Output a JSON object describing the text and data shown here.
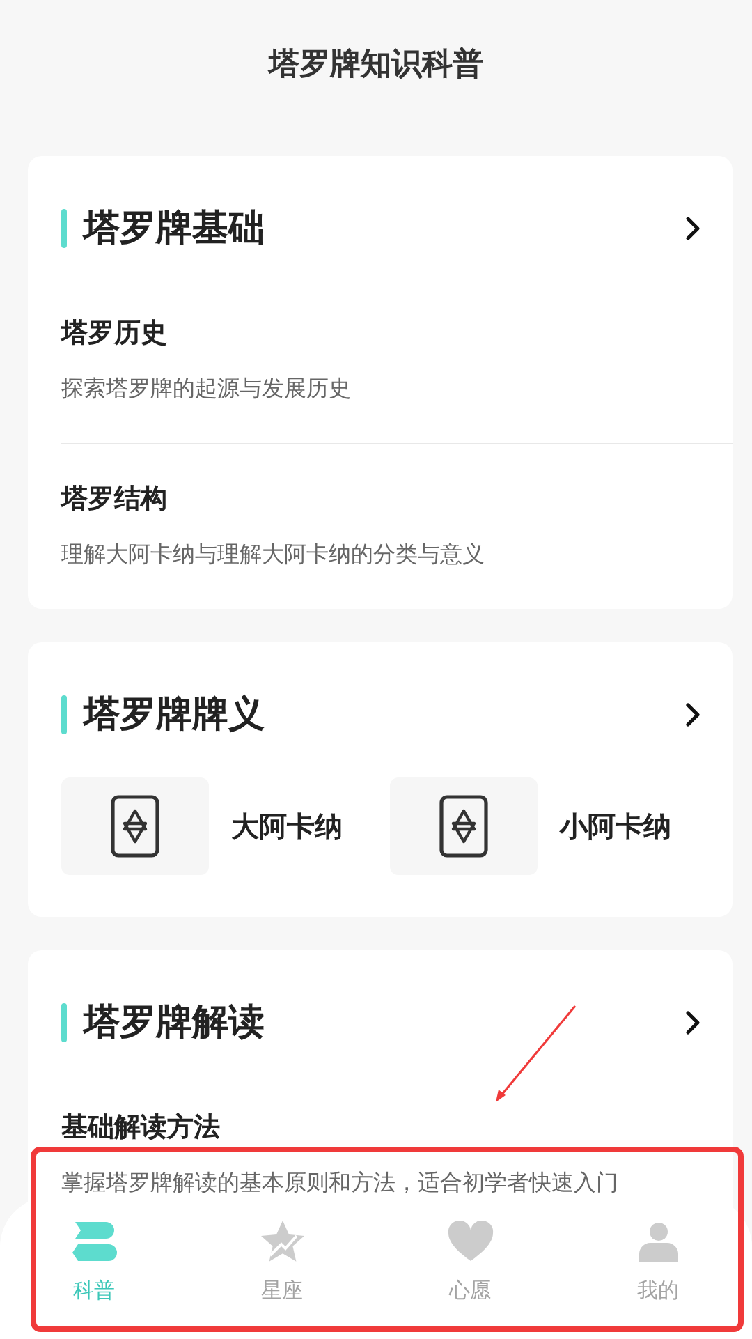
{
  "title": "塔罗牌知识科普",
  "sections": [
    {
      "kind": "list",
      "title": "塔罗牌基础",
      "items": [
        {
          "title": "塔罗历史",
          "description": "探索塔罗牌的起源与发展历史"
        },
        {
          "title": "塔罗结构",
          "description": "理解大阿卡纳与理解大阿卡纳的分类与意义"
        }
      ]
    },
    {
      "kind": "tiles",
      "title": "塔罗牌牌义",
      "tiles": [
        {
          "label": "大阿卡纳"
        },
        {
          "label": "小阿卡纳"
        }
      ]
    },
    {
      "kind": "list",
      "title": "塔罗牌解读",
      "items": [
        {
          "title": "基础解读方法",
          "description": "掌握塔罗牌解读的基本原则和方法，适合初学者快速入门"
        }
      ]
    }
  ],
  "nav": [
    {
      "label": "科普",
      "kind": "book",
      "selected": true
    },
    {
      "label": "星座",
      "kind": "star",
      "selected": false
    },
    {
      "label": "心愿",
      "kind": "heart",
      "selected": false
    },
    {
      "label": "我的",
      "kind": "person",
      "selected": false
    }
  ],
  "annotations": {
    "highlight_box": true,
    "pointer_arrow": true
  }
}
